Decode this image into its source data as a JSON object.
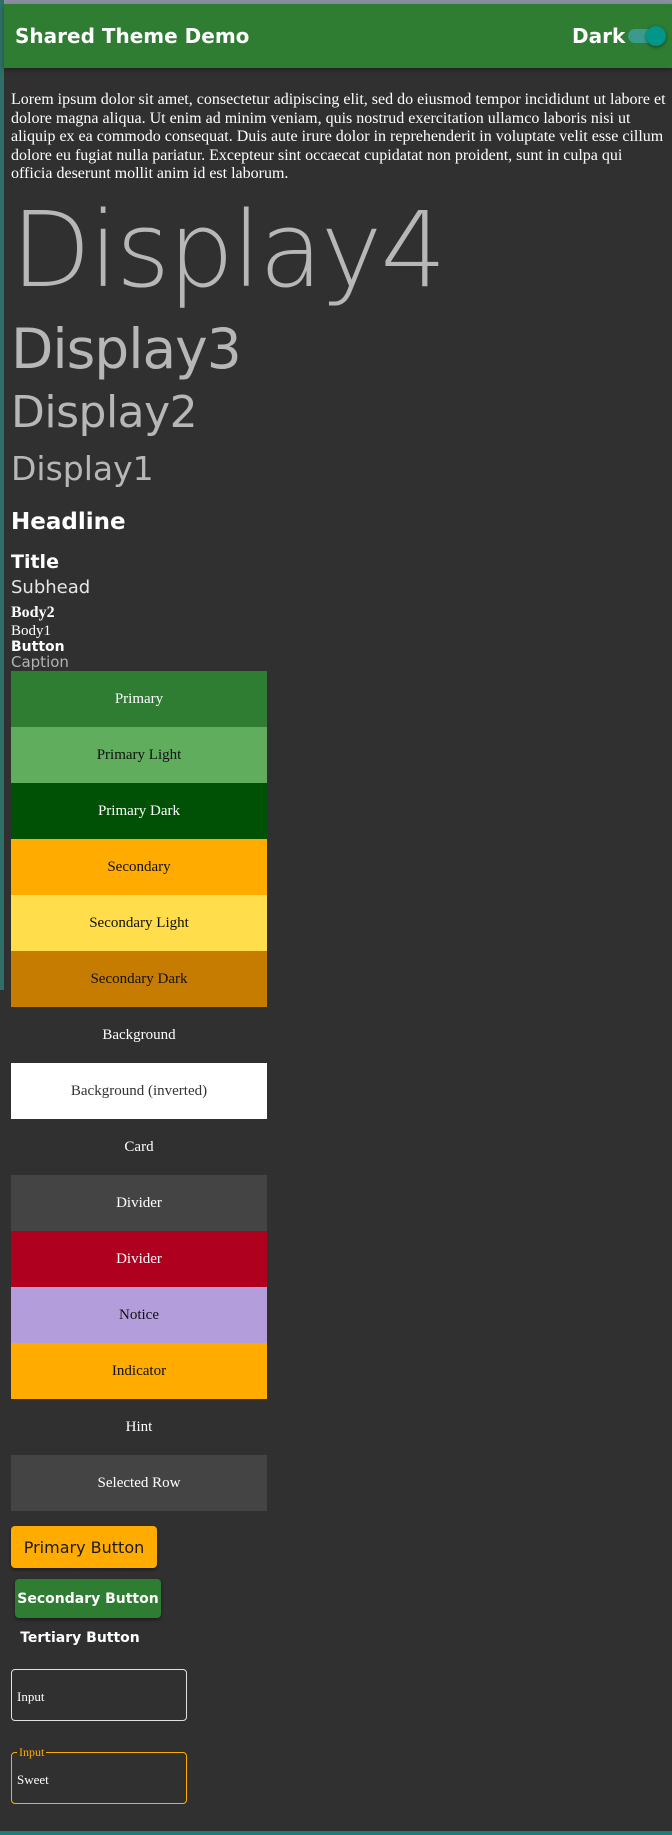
{
  "app_bar": {
    "title": "Shared Theme Demo",
    "toggle_label": "Dark",
    "toggle_on": true,
    "background": "#2e7d32"
  },
  "paragraph": "Lorem ipsum dolor sit amet, consectetur adipiscing elit, sed do eiusmod tempor incididunt ut labore et dolore magna aliqua. Ut enim ad minim veniam, quis nostrud exercitation ullamco laboris nisi ut aliquip ex ea commodo consequat. Duis aute irure dolor in reprehenderit in voluptate velit esse cillum dolore eu fugiat nulla pariatur. Excepteur sint occaecat cupidatat non proident, sunt in culpa qui officia deserunt mollit anim id est laborum.",
  "typography": {
    "display4": "Display4",
    "display3": "Display3",
    "display2": "Display2",
    "display1": "Display1",
    "headline": "Headline",
    "title": "Title",
    "subhead": "Subhead",
    "body2": "Body2",
    "body1": "Body1",
    "button": "Button",
    "caption": "Caption"
  },
  "swatches": [
    {
      "label": "Primary",
      "bg": "#2e7d32",
      "fg": "#ffffff"
    },
    {
      "label": "Primary Light",
      "bg": "#60ad5e",
      "fg": "#111111"
    },
    {
      "label": "Primary Dark",
      "bg": "#005005",
      "fg": "#ffffff"
    },
    {
      "label": "Secondary",
      "bg": "#ffab00",
      "fg": "#111111"
    },
    {
      "label": "Secondary Light",
      "bg": "#ffdd4b",
      "fg": "#111111"
    },
    {
      "label": "Secondary Dark",
      "bg": "#c67c00",
      "fg": "#111111"
    },
    {
      "label": "Background",
      "bg": "#303030",
      "fg": "#ffffff"
    },
    {
      "label": "Background (inverted)",
      "bg": "#ffffff",
      "fg": "#333333"
    },
    {
      "label": "Card",
      "bg": "#303030",
      "fg": "#ffffff"
    },
    {
      "label": "Divider",
      "bg": "#444444",
      "fg": "#ffffff"
    },
    {
      "label": "Divider",
      "bg": "#b00020",
      "fg": "#ffffff"
    },
    {
      "label": "Notice",
      "bg": "#b39ddb",
      "fg": "#111111"
    },
    {
      "label": "Indicator",
      "bg": "#ffab00",
      "fg": "#111111"
    },
    {
      "label": "Hint",
      "bg": "#303030",
      "fg": "#ffffff"
    },
    {
      "label": "Selected Row",
      "bg": "#444444",
      "fg": "#ffffff"
    }
  ],
  "buttons": {
    "primary": "Primary Button",
    "secondary": "Secondary Button",
    "tertiary": "Tertiary Button"
  },
  "inputs": {
    "plain_label": "Input",
    "sweet_label": "Input",
    "sweet_value": "Sweet"
  },
  "colors": {
    "page_background": "#303030",
    "accent": "#ffab00",
    "switch": "#009688"
  }
}
